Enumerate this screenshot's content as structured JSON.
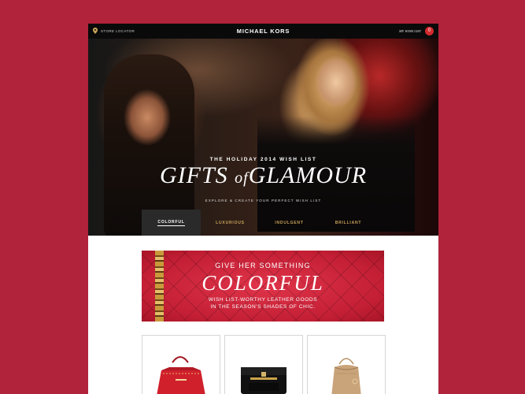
{
  "header": {
    "store_locator": "STORE LOCATOR",
    "brand": "MICHAEL KORS",
    "wish_list": "MY WISH LIST",
    "wish_count": "0"
  },
  "hero": {
    "subtitle": "THE HOLIDAY 2014 WISH LIST",
    "title_part1": "GIFTS ",
    "title_part2": "of",
    "title_part3": "GLAMOUR",
    "tagline": "EXPLORE & CREATE YOUR PERFECT WISH LIST"
  },
  "tabs": [
    {
      "label": "COLORFUL",
      "active": true
    },
    {
      "label": "LUXURIOUS",
      "active": false
    },
    {
      "label": "INDULGENT",
      "active": false
    },
    {
      "label": "BRILLIANT",
      "active": false
    }
  ],
  "banner": {
    "line1": "GIVE HER SOMETHING",
    "headline": "COLORFUL",
    "desc1": "WISH LIST-WORTHY LEATHER GOODS",
    "desc2": "IN THE SEASON'S SHADES OF CHIC."
  },
  "products": [
    {
      "name": "red-studded-tote",
      "color": "#d0202c"
    },
    {
      "name": "black-clutch",
      "color": "#111111"
    },
    {
      "name": "gold-bucket-bag",
      "color": "#c9a37a"
    }
  ],
  "colors": {
    "background": "#b0233a",
    "badge": "#d32b2f",
    "tab_text": "#c8a25a"
  }
}
